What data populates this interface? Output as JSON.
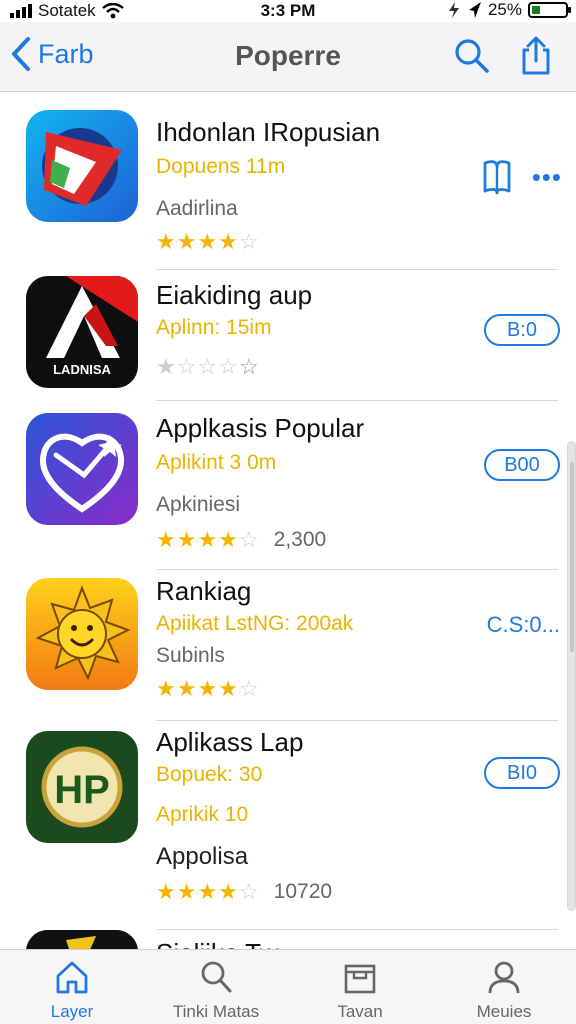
{
  "status_bar": {
    "carrier": "Sotatek",
    "time": "3:3 PM",
    "battery_text": "25%",
    "battery_level": 0.25
  },
  "nav": {
    "back_label": "Farb",
    "title": "Poperre"
  },
  "apps": [
    {
      "name": "Ihdonlan IRopusian",
      "meta": "Dopuens 11m",
      "sub": "Aadirlina",
      "stars": 4,
      "rating_count": ""
    },
    {
      "name": "Eiakiding aup",
      "meta": "Aplinn: 15im",
      "stars": 1,
      "button": "B:0"
    },
    {
      "name": "Applkasis Popular",
      "meta": "Aplikint 3 0m",
      "sub": "Apkiniesi",
      "stars": 4,
      "rating_count": "2,300",
      "button": "B00"
    },
    {
      "name": "Rankiag",
      "meta": "Apiikat LstNG: 200ak",
      "sub": "Subinls",
      "stars": 4,
      "price": "C.S:0..."
    },
    {
      "name": "Aplikass Lap",
      "meta": "Bopuek: 30",
      "meta2": "Aprikik 10",
      "sub": "Appolisa",
      "stars": 4,
      "rating_count": "10720",
      "button": "BI0"
    },
    {
      "name": "Sialiike Tw"
    }
  ],
  "tabs": [
    {
      "label": "Layer",
      "active": true
    },
    {
      "label": "Tinki Matas"
    },
    {
      "label": "Tavan"
    },
    {
      "label": "Meuies"
    }
  ],
  "colors": {
    "accent": "#1f7ae0",
    "star": "#f5b400",
    "meta_yellow": "#e8b400"
  }
}
